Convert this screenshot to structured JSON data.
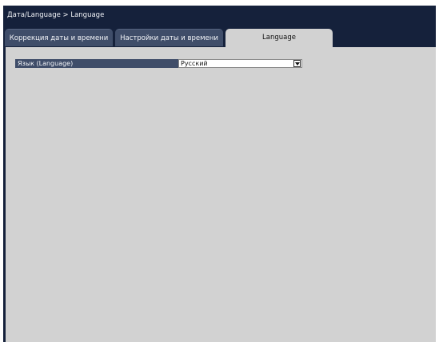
{
  "breadcrumb": "Дата/Language > Language",
  "tabs": [
    {
      "label": "Коррекция даты и времени",
      "active": false
    },
    {
      "label": "Настройки даты и времени",
      "active": false
    },
    {
      "label": "Language",
      "active": true
    }
  ],
  "language_field": {
    "label": "Язык (Language)",
    "value": "Русский",
    "arrow_icon": "dropdown-arrow-icon"
  },
  "colors": {
    "header_bg": "#15213b",
    "tab_inactive": "#3f4d69",
    "panel_bg": "#d2d2d2",
    "label_bg": "#3f4d69"
  }
}
